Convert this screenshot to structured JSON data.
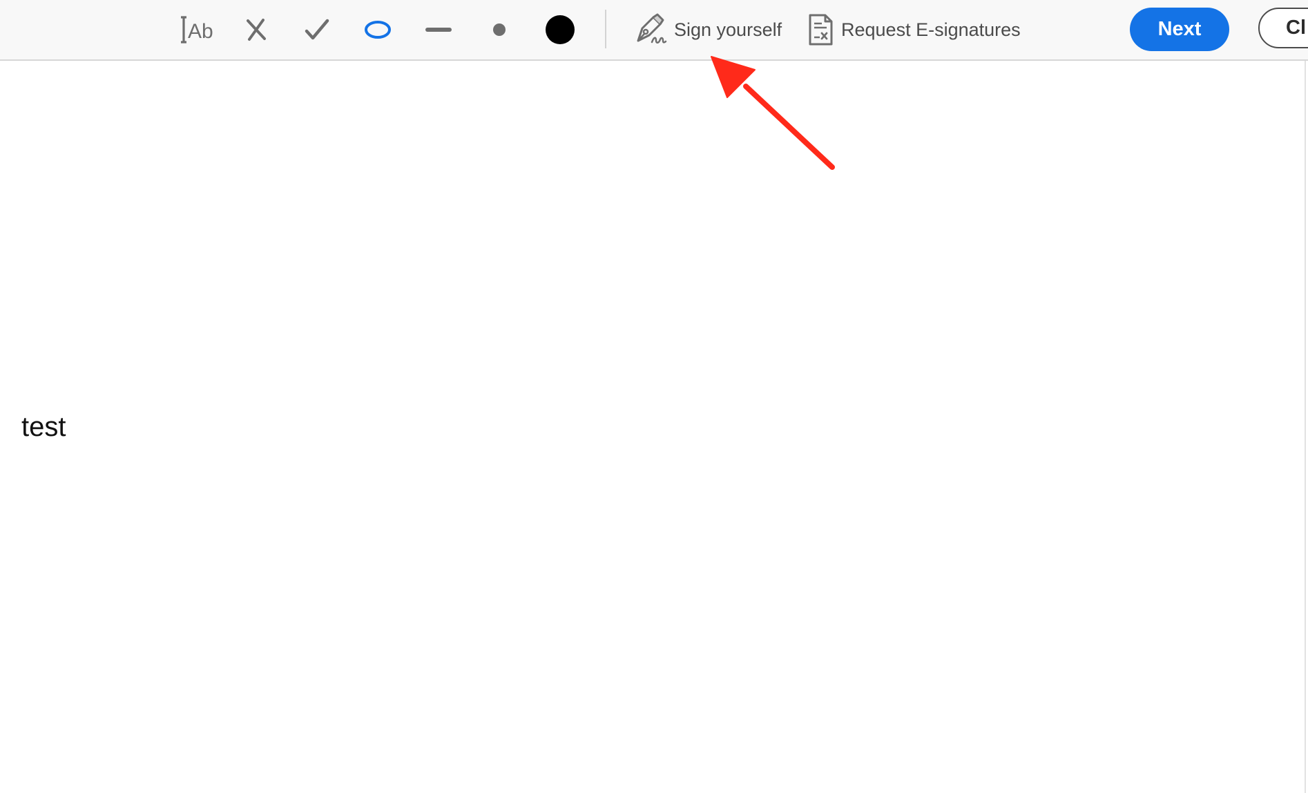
{
  "toolbar": {
    "tools": [
      {
        "name": "add-text-tool",
        "icon": "text-ab-icon"
      },
      {
        "name": "cross-mark-tool",
        "icon": "x-mark-icon"
      },
      {
        "name": "check-mark-tool",
        "icon": "check-mark-icon"
      },
      {
        "name": "circle-tool",
        "icon": "ellipse-icon"
      },
      {
        "name": "line-tool",
        "icon": "dash-line-icon"
      },
      {
        "name": "dot-tool",
        "icon": "small-dot-icon"
      },
      {
        "name": "color-picker",
        "icon": "color-swatch-icon"
      }
    ],
    "sign_yourself_label": "Sign yourself",
    "request_esignatures_label": "Request E-signatures",
    "next_label": "Next",
    "close_label": "Cl"
  },
  "document": {
    "text": "test"
  },
  "colors": {
    "accent": "#1473e6",
    "icon_gray": "#6e6e6e",
    "ellipse_blue": "#1473e6",
    "swatch": "#000000",
    "arrow": "#ff2a1a"
  }
}
